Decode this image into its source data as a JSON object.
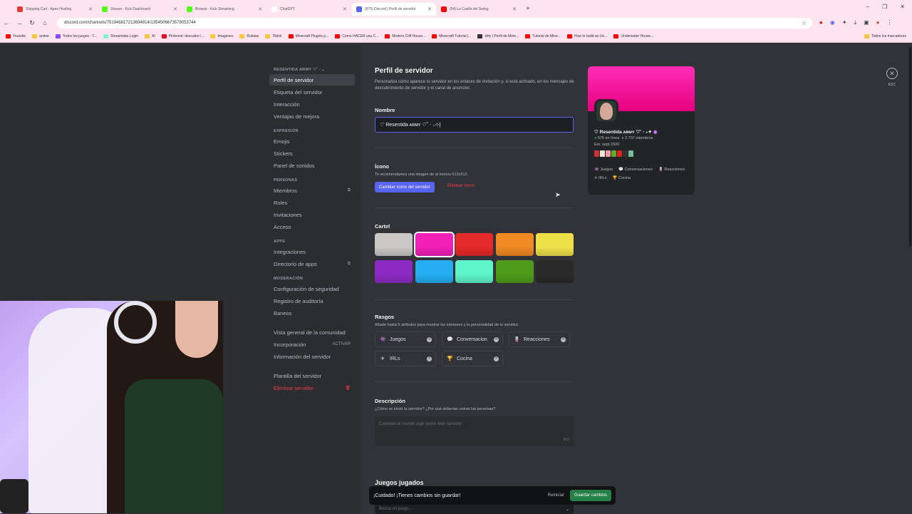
{
  "browser": {
    "tabs": [
      {
        "label": "Shipping Cart - Apex Hosting",
        "color": "#e53935",
        "active": false
      },
      {
        "label": "Stream - Kick Dashboard",
        "color": "#53fc18",
        "active": false
      },
      {
        "label": "Browse - Kick Streaming",
        "color": "#53fc18",
        "active": false
      },
      {
        "label": "ChatGPT",
        "color": "#ffffff",
        "active": false
      },
      {
        "label": "(875) Discord | Perfil de servidor",
        "color": "#5865f2",
        "active": true
      },
      {
        "label": "(54) La Cuello del Swing",
        "color": "#ff0000",
        "active": false
      }
    ],
    "url": "discord.com/channels/751946817213694814/1354506673578053744",
    "bookmarks": [
      {
        "label": "Youtube",
        "color": "#ff0000"
      },
      {
        "label": "anime",
        "color": "#f5c842"
      },
      {
        "label": "Todos los juegos - T...",
        "color": "#9147ff"
      },
      {
        "label": "Streamlabs Login",
        "color": "#80f5d2"
      },
      {
        "label": "AI",
        "color": "#f5c842"
      },
      {
        "label": "Pinterest: descubre i...",
        "color": "#e60023"
      },
      {
        "label": "Imagenes",
        "color": "#f5c842"
      },
      {
        "label": "Ruletas",
        "color": "#f5c842"
      },
      {
        "label": "Tiktok",
        "color": "#f5c842"
      },
      {
        "label": "Minecraft Plugins p...",
        "color": "#ff0000"
      },
      {
        "label": "Como HACER una C...",
        "color": "#ff0000"
      },
      {
        "label": "Modern Cliff House...",
        "color": "#ff0000"
      },
      {
        "label": "Minecraft Tutorial |...",
        "color": "#ff0000"
      },
      {
        "label": "kitty | Perfil de Mine...",
        "color": "#333333"
      },
      {
        "label": "Tutorial de Mine...",
        "color": "#ff0000"
      },
      {
        "label": "How to build an Un...",
        "color": "#ff0000"
      },
      {
        "label": "Underwater House...",
        "color": "#ff0000"
      }
    ],
    "bookmarks_right": "Todos los marcadores"
  },
  "sidebar": {
    "server_header": "RESENTIDA ARMY ♡˚ ‧ ₊",
    "groups": [
      {
        "title": "",
        "items": [
          {
            "label": "Perfil de servidor",
            "selected": true
          },
          {
            "label": "Etiqueta del servidor"
          },
          {
            "label": "Interacción"
          },
          {
            "label": "Ventajas de mejora"
          }
        ]
      },
      {
        "title": "EXPRESIÓN",
        "items": [
          {
            "label": "Emojis"
          },
          {
            "label": "Stickers"
          },
          {
            "label": "Panel de sonidos"
          }
        ]
      },
      {
        "title": "PERSONAS",
        "items": [
          {
            "label": "Miembros",
            "external": true
          },
          {
            "label": "Roles"
          },
          {
            "label": "Invitaciones"
          },
          {
            "label": "Acceso"
          }
        ]
      },
      {
        "title": "APPS",
        "items": [
          {
            "label": "Integraciones"
          },
          {
            "label": "Directorio de apps",
            "external": true
          }
        ]
      },
      {
        "title": "MODERACIÓN",
        "items": [
          {
            "label": "Configuración de seguridad"
          },
          {
            "label": "Registro de auditoría"
          },
          {
            "label": "Baneos"
          }
        ]
      },
      {
        "title": "",
        "items": [
          {
            "label": "Vista general de la comunidad"
          },
          {
            "label": "Incorporación",
            "right": "ACTIVAR"
          },
          {
            "label": "Información del servidor"
          }
        ]
      },
      {
        "title": "",
        "items": [
          {
            "label": "Plantilla del servidor"
          },
          {
            "label": "Eliminar servidor",
            "danger": true
          }
        ]
      }
    ]
  },
  "main": {
    "title": "Perfil de servidor",
    "subtitle": "Personaliza cómo aparece tu servidor en los enlaces de invitación y, si está activado, en los mensajes de descubrimiento de servidor y el canal de anuncios",
    "name_label": "Nombre",
    "name_value": "♡ Resentida ᴀʀᴍʏ ♡˚ ‧ ₊⊹",
    "icon_label": "Ícono",
    "icon_hint": "Te recomendamos una imagen de al menos 512x512.",
    "change_icon": "Cambiar ícono del servidor",
    "remove_icon": "Eliminar ícono",
    "banner_label": "Cartel",
    "swatches": [
      "#c9c6c6",
      "#f01fb8",
      "#e52a2a",
      "#f08a23",
      "#efe04a",
      "#8c2ac4",
      "#25aef2",
      "#5ff3c9",
      "#4e9c1a",
      "#2a2a2a"
    ],
    "selected_swatch": 1,
    "traits_label": "Rasgos",
    "traits_hint": "Añade hasta 5 atributos para mostrar los intereses y la personalidad de tu servidor.",
    "traits": [
      {
        "icon": "👾",
        "label": "Juegos"
      },
      {
        "icon": "💬",
        "label": "Conversacion"
      },
      {
        "icon": "🪫",
        "label": "Reacciones"
      },
      {
        "icon": "✈",
        "label": "IRLs"
      },
      {
        "icon": "🏆",
        "label": "Cocina"
      }
    ],
    "desc_label": "Descripción",
    "desc_hint": "¿Cómo se inició tu servidor? ¿Por qué deberían unirse las personas?",
    "desc_placeholder": "Cuéntale al mundo algo sobre este servidor.",
    "desc_count": "300",
    "games_label": "Juegos jugados",
    "games_placeholder": "Busca un juego...",
    "unsaved_text": "¡Cuidado! ¡Tienes cambios sin guardar!",
    "reset_label": "Reiniciar",
    "save_label": "Guardar cambios",
    "esc_label": "ESC"
  },
  "preview": {
    "name": "♡ Resentida ᴀʀᴍʏ ♡˚ ‧ ₊✦",
    "online": "576 en línea",
    "members": "2.707 miembros",
    "est": "Est. sept 2020",
    "emoji_colors": [
      "#c33",
      "#f3e5d8",
      "#e9a",
      "#6a2",
      "#d22",
      "#333",
      "#7b9"
    ],
    "traits": [
      "Juegos",
      "Conversaciones",
      "Reacciones",
      "IRLs",
      "Cocina"
    ]
  }
}
